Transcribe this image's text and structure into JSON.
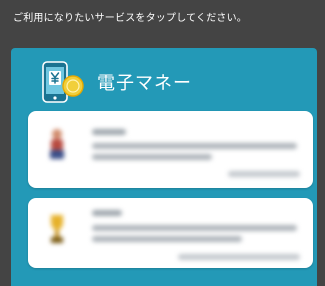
{
  "screen": {
    "instruction": "ご利用になりたいサービスをタップしてください。"
  },
  "panel": {
    "title": "電子マネー",
    "icon": "phone-yen-coin-icon",
    "accent_color": "#2399b7"
  },
  "cards": [
    {
      "icon": "figure-thumbnail-icon"
    },
    {
      "icon": "trophy-thumbnail-icon"
    }
  ]
}
